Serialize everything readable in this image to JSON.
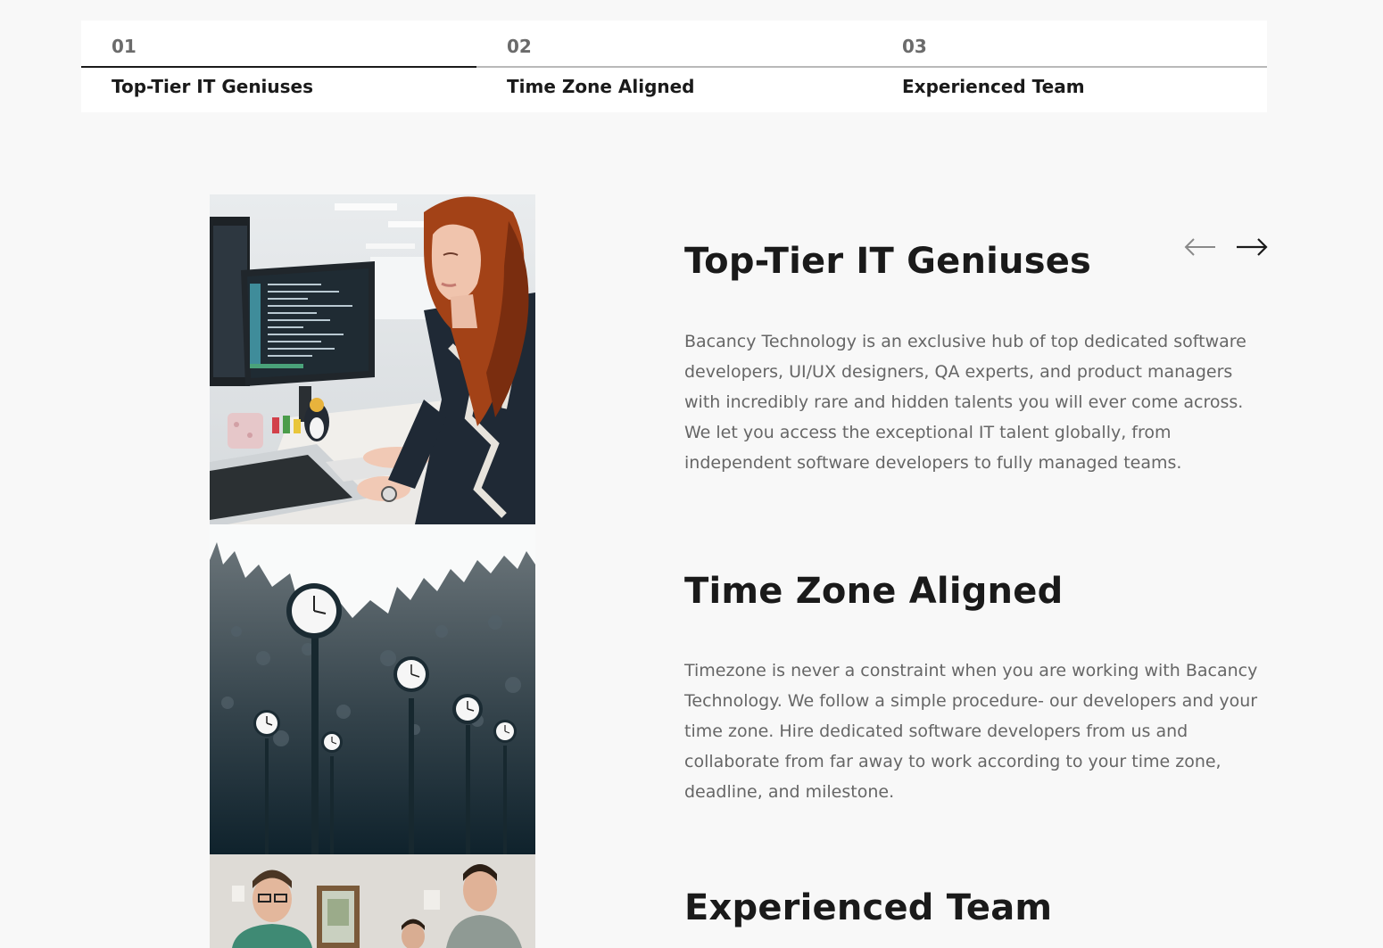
{
  "tabs": [
    {
      "number": "01",
      "label": "Top-Tier IT Geniuses",
      "active": true
    },
    {
      "number": "02",
      "label": "Time Zone Aligned",
      "active": false
    },
    {
      "number": "03",
      "label": "Experienced Team",
      "active": false
    }
  ],
  "sections": [
    {
      "title": "Top-Tier IT Geniuses",
      "body": "Bacancy Technology is an exclusive hub of top dedicated software developers, UI/UX designers, QA experts, and product managers with incredibly rare and hidden talents you will ever come across. We let you access the exceptional IT talent globally, from independent software developers to fully managed teams."
    },
    {
      "title": "Time Zone Aligned",
      "body": "Timezone is never a constraint when you are working with Bacancy Technology. We follow a simple procedure- our developers and your time zone. Hire dedicated software developers from us and collaborate from far away to work according to your time zone, deadline, and milestone."
    },
    {
      "title": "Experienced Team",
      "body": ""
    }
  ],
  "navigation": {
    "prev_icon": "arrow-left-icon",
    "next_icon": "arrow-right-icon"
  },
  "colors": {
    "background": "#f8f8f8",
    "heading": "#1a1a1a",
    "body_text": "#666666",
    "tab_active_line": "#1a1a1a",
    "tab_inactive_line": "#b9b9b9"
  }
}
